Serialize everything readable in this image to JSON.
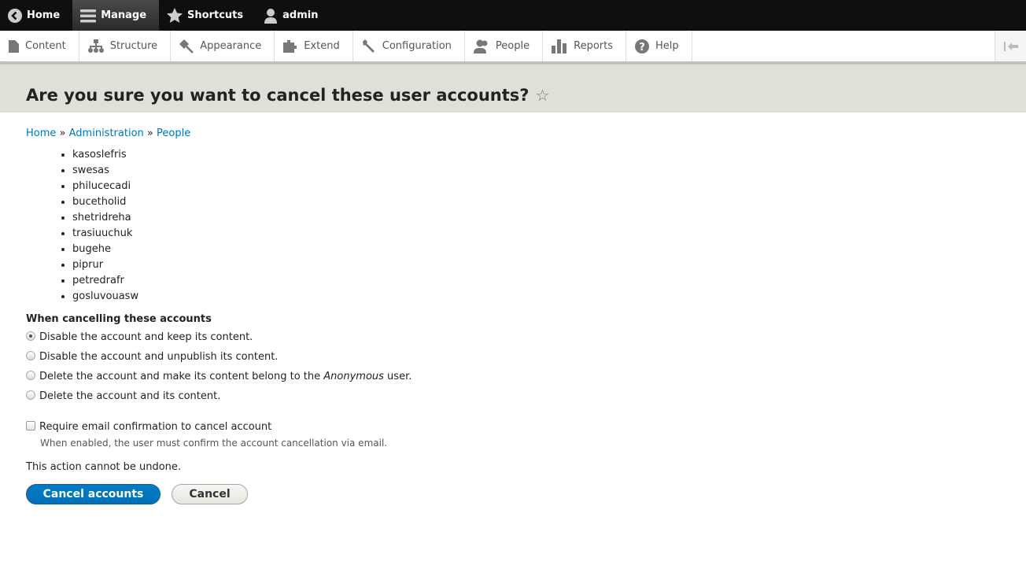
{
  "toolbar": {
    "home": "Home",
    "manage": "Manage",
    "shortcuts": "Shortcuts",
    "user": "admin"
  },
  "tray": [
    "Content",
    "Structure",
    "Appearance",
    "Extend",
    "Configuration",
    "People",
    "Reports",
    "Help"
  ],
  "page": {
    "title": "Are you sure you want to cancel these user accounts?"
  },
  "breadcrumb": {
    "home": "Home",
    "admin": "Administration",
    "people": "People",
    "sep": "»"
  },
  "accounts": [
    "kasoslefris",
    "swesas",
    "philucecadi",
    "bucetholid",
    "shetridreha",
    "trasiuuchuk",
    "bugehe",
    "piprur",
    "petredrafr",
    "gosluvouasw"
  ],
  "form": {
    "legend": "When cancelling these accounts",
    "options": [
      "Disable the account and keep its content.",
      "Disable the account and unpublish its content.",
      "Delete the account and make its content belong to the ",
      "Delete the account and its content."
    ],
    "anon": "Anonymous",
    "anon_suffix": " user.",
    "selected": 0,
    "confirm_label": "Require email confirmation to cancel account",
    "confirm_desc": "When enabled, the user must confirm the account cancellation via email.",
    "warning": "This action cannot be undone.",
    "submit": "Cancel accounts",
    "cancel": "Cancel"
  }
}
